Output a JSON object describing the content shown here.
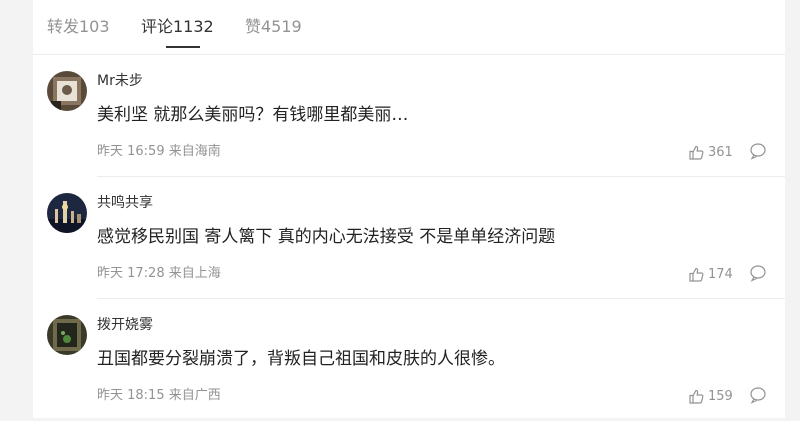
{
  "tabs": [
    {
      "label": "转发103"
    },
    {
      "label": "评论1132"
    },
    {
      "label": "赞4519"
    }
  ],
  "active_tab": "评论1132",
  "comments": [
    {
      "username": "Mr未步",
      "text": "美利坚 就那么美丽吗？有钱哪里都美丽…",
      "meta": "昨天 16:59 来自海南",
      "likes": "361"
    },
    {
      "username": "共鸣共享",
      "text": "感觉移民别国 寄人篱下 真的内心无法接受 不是单单经济问题",
      "meta": "昨天 17:28 来自上海",
      "likes": "174"
    },
    {
      "username": "拨开娆雾",
      "text": "丑国都要分裂崩溃了，背叛自己祖国和皮肤的人很惨。",
      "meta": "昨天 18:15 来自广西",
      "likes": "159"
    }
  ],
  "icons": {
    "like": "thumbs-up-icon",
    "reply": "comment-bubble-icon"
  },
  "colors": {
    "text_primary": "#333333",
    "text_secondary": "#939393",
    "divider": "#ececec",
    "page_bg": "#f3f3f3"
  }
}
